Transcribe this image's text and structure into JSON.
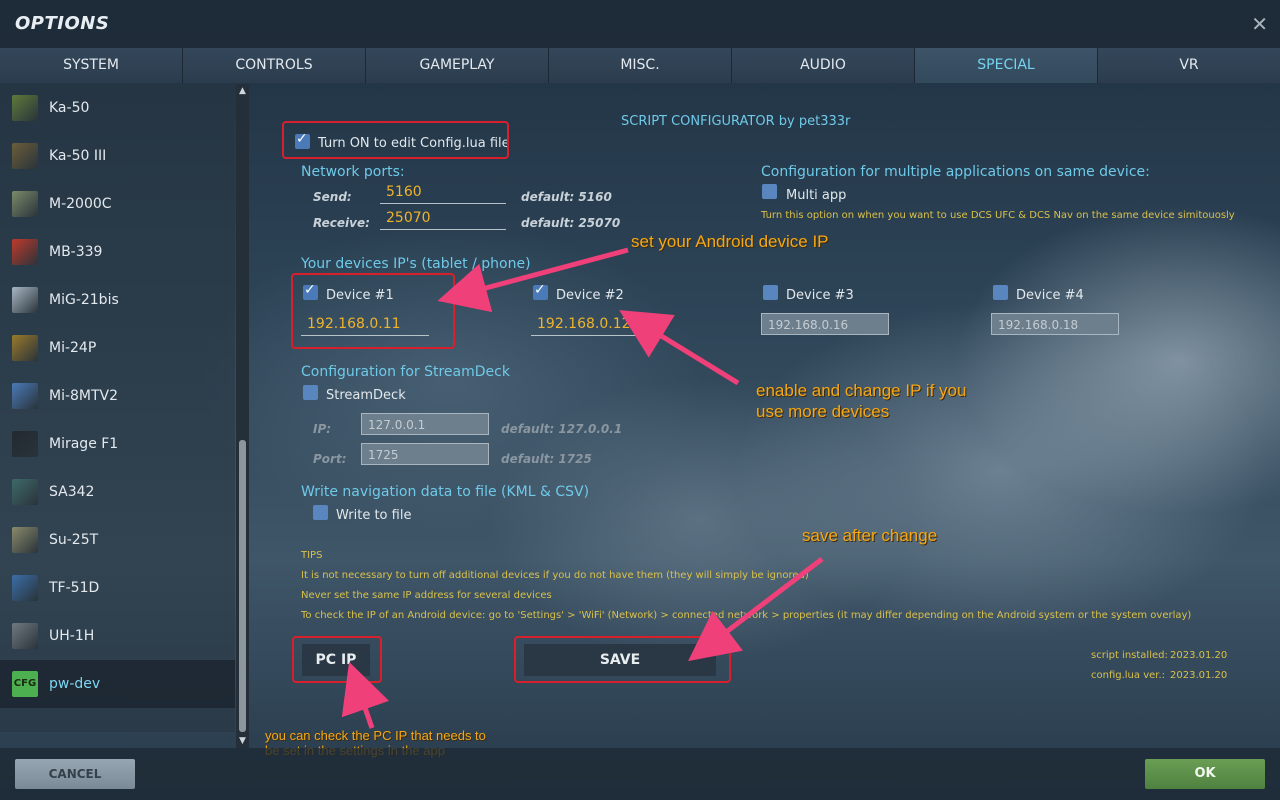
{
  "window": {
    "title": "OPTIONS",
    "close_icon": "close-icon"
  },
  "tabs": [
    {
      "label": "SYSTEM",
      "active": false
    },
    {
      "label": "CONTROLS",
      "active": false
    },
    {
      "label": "GAMEPLAY",
      "active": false
    },
    {
      "label": "MISC.",
      "active": false
    },
    {
      "label": "AUDIO",
      "active": false
    },
    {
      "label": "SPECIAL",
      "active": true
    },
    {
      "label": "VR",
      "active": false
    }
  ],
  "sidebar": {
    "items": [
      {
        "label": "Ka-50",
        "icon": "ka-50-icon",
        "color": "#5e7a3a"
      },
      {
        "label": "Ka-50 III",
        "icon": "ka-50-iii-icon",
        "color": "#6b5e3a"
      },
      {
        "label": "M-2000C",
        "icon": "m-2000c-icon",
        "color": "#7a8a6a"
      },
      {
        "label": "MB-339",
        "icon": "mb-339-icon",
        "color": "#c0392b"
      },
      {
        "label": "MiG-21bis",
        "icon": "mig-21bis-icon",
        "color": "#a9b8c4"
      },
      {
        "label": "Mi-24P",
        "icon": "mi-24p-icon",
        "color": "#9a7a2a"
      },
      {
        "label": "Mi-8MTV2",
        "icon": "mi-8mtv2-icon",
        "color": "#4a7ab8"
      },
      {
        "label": "Mirage F1",
        "icon": "mirage-f1-icon",
        "color": "#222a30"
      },
      {
        "label": "SA342",
        "icon": "sa342-icon",
        "color": "#3e6a6a"
      },
      {
        "label": "Su-25T",
        "icon": "su-25t-icon",
        "color": "#8a8a6a"
      },
      {
        "label": "TF-51D",
        "icon": "tf-51d-icon",
        "color": "#3b6ea8"
      },
      {
        "label": "UH-1H",
        "icon": "uh-1h-icon",
        "color": "#707a80"
      },
      {
        "label": "pw-dev",
        "icon": "cfg-icon",
        "color": "#4caf50",
        "icon_text": "CFG",
        "selected": true
      }
    ]
  },
  "config": {
    "header": "SCRIPT CONFIGURATOR by pet333r",
    "turn_on_label": "Turn ON to edit Config.lua file",
    "turn_on_checked": true,
    "network": {
      "title": "Network ports:",
      "send_label": "Send:",
      "send_value": "5160",
      "send_default": "default: 5160",
      "receive_label": "Receive:",
      "receive_value": "25070",
      "receive_default": "default: 25070"
    },
    "multi": {
      "title": "Configuration for multiple applications on same device:",
      "label": "Multi app",
      "checked": false,
      "note": "Turn this option on when you want to use DCS UFC & DCS Nav on the same device simitouosly"
    },
    "devices": {
      "title": "Your devices IP's (tablet / phone)",
      "list": [
        {
          "label": "Device #1",
          "ip": "192.168.0.11",
          "checked": true
        },
        {
          "label": "Device #2",
          "ip": "192.168.0.12",
          "checked": true
        },
        {
          "label": "Device #3",
          "ip": "192.168.0.16",
          "checked": false
        },
        {
          "label": "Device #4",
          "ip": "192.168.0.18",
          "checked": false
        }
      ]
    },
    "streamdeck": {
      "title": "Configuration for StreamDeck",
      "label": "StreamDeck",
      "checked": false,
      "ip_label": "IP:",
      "ip_value": "127.0.0.1",
      "ip_default": "default: 127.0.0.1",
      "port_label": "Port:",
      "port_value": "1725",
      "port_default": "default: 1725"
    },
    "navigation": {
      "title": "Write navigation data to file (KML & CSV)",
      "label": "Write to file",
      "checked": false
    },
    "tips": {
      "title": "TIPS",
      "lines": [
        "It is not necessary to turn off additional devices if you do not have them (they will simply be ignored)",
        "Never set the same IP address for several devices",
        "To check the IP of an Android device: go to 'Settings' > 'WiFi' (Network) > connected network > properties (it may differ depending on the Android system or the system overlay)"
      ]
    },
    "pc_ip_button": "PC IP",
    "save_button": "SAVE",
    "script_installed_label": "script installed:",
    "script_installed_value": "2023.01.20",
    "config_ver_label": "config.lua ver.:",
    "config_ver_value": "2023.01.20"
  },
  "annotations": {
    "set_android": "set your Android device IP",
    "enable_more_1": "enable and change IP if you",
    "enable_more_2": "use more devices",
    "save_after": "save after change",
    "pc_ip_1": "you can check the PC IP that needs to",
    "pc_ip_2": "be set in the settings in the app",
    "color": "#f6a712",
    "arrow_color": "#f0407a"
  },
  "footer": {
    "cancel": "CANCEL",
    "ok": "OK"
  }
}
